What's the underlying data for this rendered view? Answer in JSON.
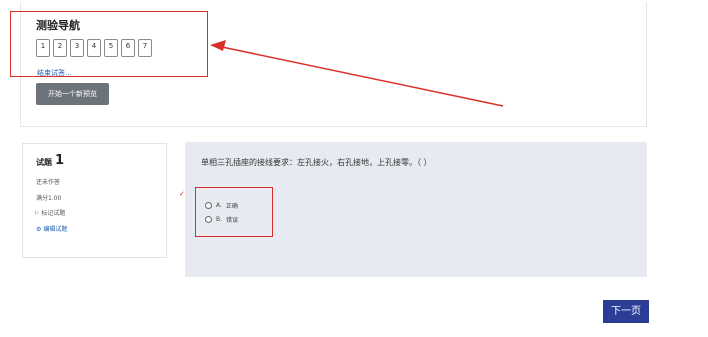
{
  "nav": {
    "title": "测验导航",
    "pages": [
      "1",
      "2",
      "3",
      "4",
      "5",
      "6",
      "7"
    ],
    "finish_link": "结束试答...",
    "start_button": "开始一个新预览"
  },
  "question_info": {
    "label": "试题",
    "number": "1",
    "status": "还未作答",
    "score": "满分1.00",
    "flag": "标记试题",
    "edit": "编辑试题"
  },
  "question": {
    "text": "单相三孔插座的接线要求：左孔接火，右孔接地，上孔接零。（  ）",
    "options": [
      {
        "letter": "A.",
        "label": "正确"
      },
      {
        "letter": "B.",
        "label": "错误"
      }
    ]
  },
  "next_button": "下一页",
  "colors": {
    "annotation_red": "#d9312a",
    "next_button_bg": "#2b3d95",
    "start_button_bg": "#6c737b",
    "question_panel_bg": "#e7eaf1"
  }
}
